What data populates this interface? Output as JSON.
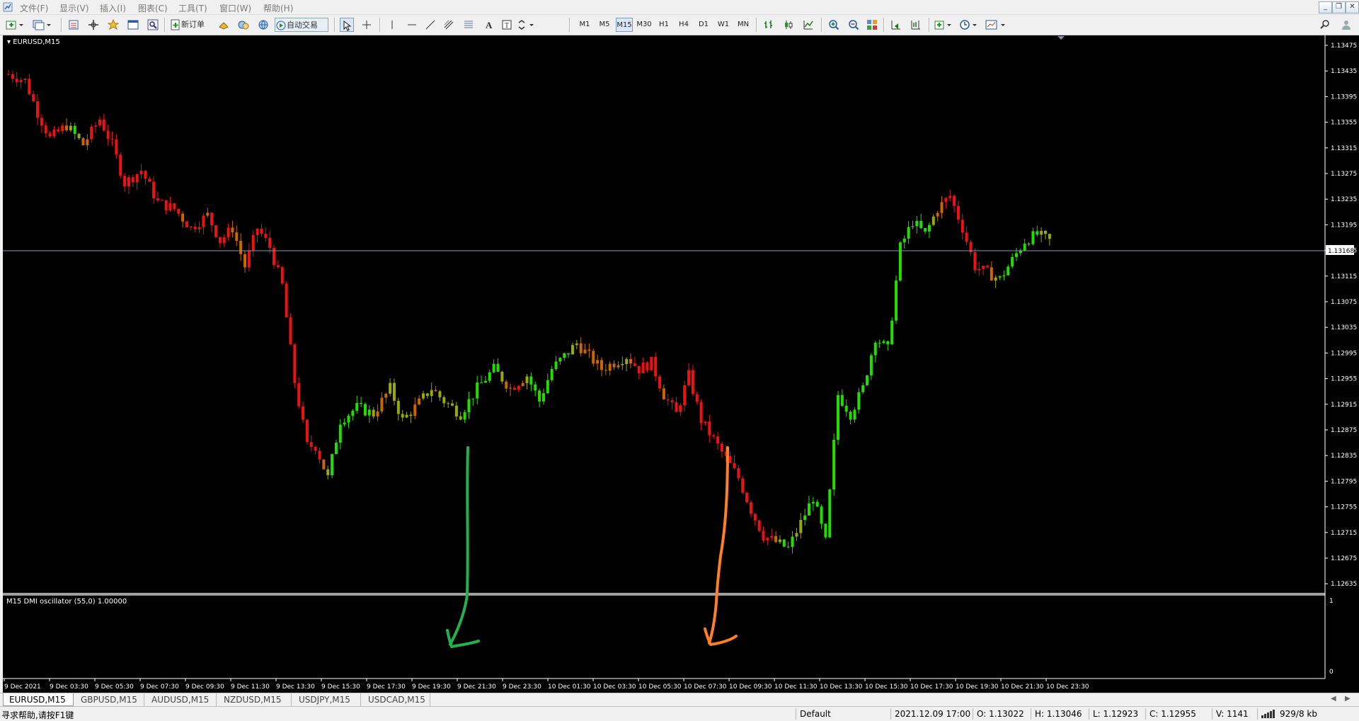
{
  "menu": {
    "items": [
      "文件(F)",
      "显示(V)",
      "插入(I)",
      "图表(C)",
      "工具(T)",
      "窗口(W)",
      "帮助(H)"
    ]
  },
  "toolbar": {
    "new_order_label": "新订单",
    "auto_trading_label": "自动交易",
    "timeframes": [
      "M1",
      "M5",
      "M15",
      "M30",
      "H1",
      "H4",
      "D1",
      "W1",
      "MN"
    ],
    "active_timeframe": "M15"
  },
  "chart": {
    "window_title": "EURUSD,M15",
    "indicator_title": "M15 DMI oscillator (55,0) 1.00000",
    "current_price_label": "1.13168",
    "indicator_axis_top": "1",
    "indicator_axis_bottom": "0"
  },
  "chart_data": {
    "type": "candlestick",
    "symbol": "EURUSD",
    "timeframe": "M15",
    "y_ticks": [
      "1.13475",
      "1.13435",
      "1.13395",
      "1.13355",
      "1.13315",
      "1.13275",
      "1.13235",
      "1.13195",
      "1.13155",
      "1.13115",
      "1.13075",
      "1.13035",
      "1.12995",
      "1.12955",
      "1.12915",
      "1.12875",
      "1.12835",
      "1.12795",
      "1.12755",
      "1.12715",
      "1.12675",
      "1.12635"
    ],
    "ylim": [
      1.12625,
      1.135
    ],
    "current_price": 1.13168,
    "x_ticks": [
      "9 Dec 2021",
      "9 Dec 03:30",
      "9 Dec 05:30",
      "9 Dec 07:30",
      "9 Dec 09:30",
      "9 Dec 11:30",
      "9 Dec 13:30",
      "9 Dec 15:30",
      "9 Dec 17:30",
      "9 Dec 19:30",
      "9 Dec 21:30",
      "9 Dec 23:30",
      "10 Dec 01:30",
      "10 Dec 03:30",
      "10 Dec 05:30",
      "10 Dec 07:30",
      "10 Dec 09:30",
      "10 Dec 11:30",
      "10 Dec 13:30",
      "10 Dec 15:30",
      "10 Dec 17:30",
      "10 Dec 19:30",
      "10 Dec 21:30",
      "10 Dec 23:30"
    ],
    "close_path": [
      [
        0,
        1.1343
      ],
      [
        4,
        1.1342
      ],
      [
        7,
        1.1337
      ],
      [
        10,
        1.1333
      ],
      [
        14,
        1.1335
      ],
      [
        18,
        1.1332
      ],
      [
        22,
        1.1336
      ],
      [
        25,
        1.1332
      ],
      [
        28,
        1.1326
      ],
      [
        32,
        1.1328
      ],
      [
        36,
        1.1323
      ],
      [
        40,
        1.1322
      ],
      [
        44,
        1.1319
      ],
      [
        48,
        1.1321
      ],
      [
        51,
        1.1317
      ],
      [
        54,
        1.1319
      ],
      [
        57,
        1.1313
      ],
      [
        60,
        1.1319
      ],
      [
        63,
        1.1316
      ],
      [
        66,
        1.131
      ],
      [
        69,
        1.1295
      ],
      [
        72,
        1.1285
      ],
      [
        74,
        1.1285
      ],
      [
        77,
        1.128
      ],
      [
        80,
        1.1289
      ],
      [
        84,
        1.1291
      ],
      [
        88,
        1.129
      ],
      [
        92,
        1.1294
      ],
      [
        95,
        1.1289
      ],
      [
        98,
        1.1291
      ],
      [
        102,
        1.1294
      ],
      [
        105,
        1.1292
      ],
      [
        109,
        1.129
      ],
      [
        113,
        1.1294
      ],
      [
        117,
        1.1297
      ],
      [
        121,
        1.1294
      ],
      [
        125,
        1.1296
      ],
      [
        128,
        1.1292
      ],
      [
        131,
        1.1297
      ],
      [
        134,
        1.1299
      ],
      [
        137,
        1.1301
      ],
      [
        140,
        1.1299
      ],
      [
        143,
        1.1297
      ],
      [
        146,
        1.1298
      ],
      [
        149,
        1.1299
      ],
      [
        152,
        1.1297
      ],
      [
        155,
        1.1298
      ],
      [
        158,
        1.1293
      ],
      [
        161,
        1.129
      ],
      [
        164,
        1.1296
      ],
      [
        167,
        1.1289
      ],
      [
        170,
        1.1286
      ],
      [
        173,
        1.1283
      ],
      [
        176,
        1.128
      ],
      [
        179,
        1.1275
      ],
      [
        182,
        1.1271
      ],
      [
        185,
        1.127
      ],
      [
        188,
        1.1269
      ],
      [
        191,
        1.1273
      ],
      [
        194,
        1.1277
      ],
      [
        197,
        1.127
      ],
      [
        200,
        1.1293
      ],
      [
        203,
        1.129
      ],
      [
        206,
        1.1294
      ],
      [
        209,
        1.1302
      ],
      [
        212,
        1.13
      ],
      [
        215,
        1.1316
      ],
      [
        218,
        1.132
      ],
      [
        221,
        1.1318
      ],
      [
        224,
        1.1322
      ],
      [
        227,
        1.1324
      ],
      [
        230,
        1.1319
      ],
      [
        233,
        1.1313
      ],
      [
        236,
        1.1312
      ],
      [
        239,
        1.1311
      ],
      [
        242,
        1.1314
      ],
      [
        245,
        1.1317
      ],
      [
        248,
        1.1318
      ],
      [
        251,
        1.1317
      ]
    ],
    "bar_count": 252,
    "annotations": [
      {
        "type": "hand-drawn-arrow",
        "color": "#22b14c",
        "direction": "down"
      },
      {
        "type": "hand-drawn-arrow",
        "color": "#ff7f27",
        "direction": "down"
      }
    ]
  },
  "tabs": {
    "items": [
      "EURUSD,M15",
      "GBPUSD,M15",
      "AUDUSD,M15",
      "NZDUSD,M15",
      "USDJPY,M15",
      "USDCAD,M15"
    ],
    "active": "EURUSD,M15"
  },
  "status": {
    "help_text": "寻求帮助,请按F1键",
    "profile": "Default",
    "datetime": "2021.12.09 17:00",
    "open": "O: 1.13022",
    "high": "H: 1.13046",
    "low": "L: 1.12923",
    "close": "C: 1.12955",
    "volume": "V: 1141",
    "traffic": "929/8 kb"
  },
  "colors": {
    "bull": "#22dd00",
    "bear": "#ee1111",
    "neutral_up": "#99aa00",
    "neutral_down": "#cc6600",
    "background": "#000000",
    "axis_text": "#ffffff",
    "price_line": "#7f9cb8"
  }
}
